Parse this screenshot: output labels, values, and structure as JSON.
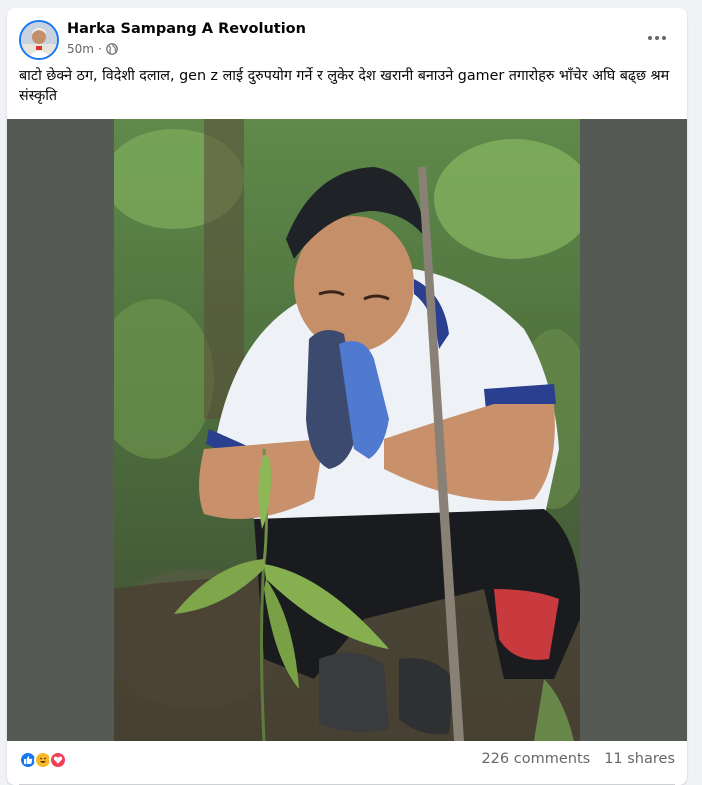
{
  "post": {
    "author_name": "Harka Sampang A Revolution",
    "time": "50m",
    "separator": "·",
    "caption": "बाटो छेक्ने ठग, विदेशी दलाल, gen z लाई दुरुपयोग गर्ने र लुकेर देश खरानी बनाउने gamer तगारोहरु भाँचेर अघि बढ्छ  श्रम संस्कृति"
  },
  "footer": {
    "comments": "226 comments",
    "shares": "11 shares",
    "reactions": [
      "like-icon",
      "haha-icon",
      "love-icon"
    ]
  },
  "colors": {
    "accent": "#1877f2",
    "like": "#1877f2",
    "haha": "#f7b928",
    "love": "#f33e58",
    "photo_background": "#565a55"
  }
}
